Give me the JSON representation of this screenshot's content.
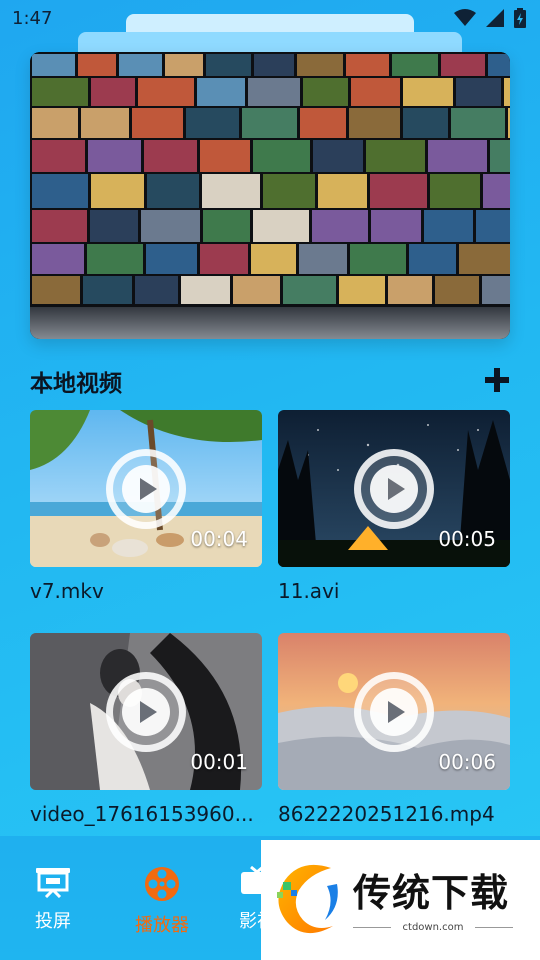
{
  "status_bar": {
    "time": "1:47"
  },
  "section": {
    "title": "本地视频"
  },
  "videos": [
    {
      "filename": "v7.mkv",
      "duration": "00:04"
    },
    {
      "filename": "11.avi",
      "duration": "00:05"
    },
    {
      "filename": "video_17616153960...",
      "duration": "00:01"
    },
    {
      "filename": "8622220251216.mp4",
      "duration": "00:06"
    }
  ],
  "bottom_nav": {
    "items": [
      {
        "label": "投屏",
        "icon": "projector-icon",
        "active": false
      },
      {
        "label": "播放器",
        "icon": "film-reel-icon",
        "active": true
      },
      {
        "label": "影视",
        "icon": "tv-icon",
        "active": false
      }
    ]
  },
  "watermark": {
    "brand": "传统下载",
    "url": "ctdown.com"
  },
  "colors": {
    "accent": "#f26a10",
    "background": "#22b8f2"
  }
}
